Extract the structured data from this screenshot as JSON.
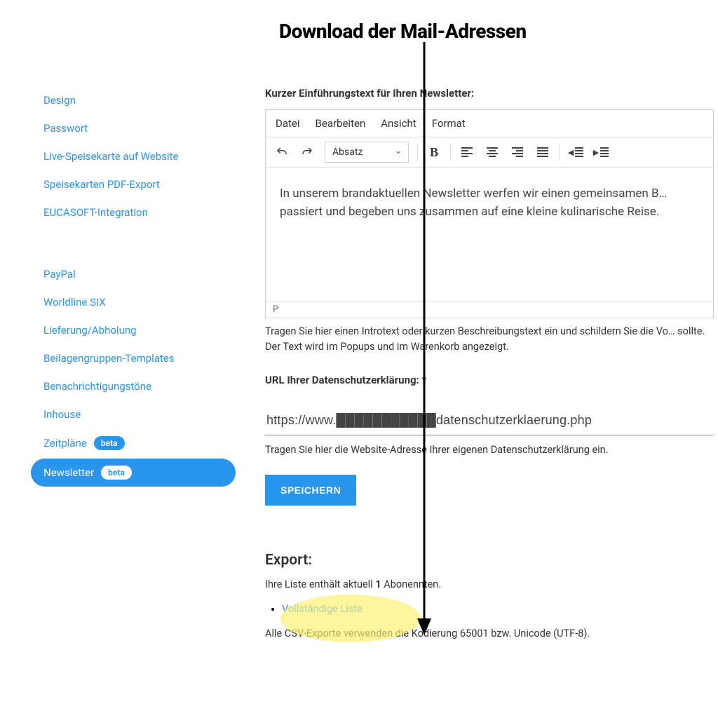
{
  "annotation": {
    "title": "Download der Mail-Adressen"
  },
  "sidebar": {
    "items": [
      {
        "label": "Design"
      },
      {
        "label": "Passwort"
      },
      {
        "label": "Live-Speisekarte auf Website"
      },
      {
        "label": "Speisekarten PDF-Export"
      },
      {
        "label": "EUCASOFT-Integration"
      }
    ],
    "items2": [
      {
        "label": "PayPal"
      },
      {
        "label": "Worldline SIX"
      },
      {
        "label": "Lieferung/Abholung"
      },
      {
        "label": "Beilagengruppen-Templates"
      },
      {
        "label": "Benachrichtigungstöne"
      },
      {
        "label": "Inhouse"
      },
      {
        "label": "Zeitpläne",
        "badge": "beta"
      },
      {
        "label": "Newsletter",
        "badge": "beta",
        "active": true
      }
    ]
  },
  "main": {
    "intro_label": "Kurzer Einführungstext für Ihren Newsletter:",
    "editor_menu": {
      "file": "Datei",
      "edit": "Bearbeiten",
      "view": "Ansicht",
      "format": "Format"
    },
    "editor_block": "Absatz",
    "editor_content": "In unserem brandaktuellen Newsletter werfen wir einen gemeinsamen B… passiert und begeben uns zusammen auf eine kleine kulinarische Reise.",
    "editor_status": "P",
    "intro_helper": "Tragen Sie hier einen Introtext oder kurzen Beschreibungstext ein und schildern Sie die Vo… sollte. Der Text wird im Popups und im Warenkorb angezeigt.",
    "url_label": "URL Ihrer Datenschutzerklärung: *",
    "url_value": "https://www.███████████datenschutzerklaerung.php",
    "url_helper": "Tragen Sie hier die Website-Adresse Ihrer eigenen Datenschutzerklärung ein.",
    "save": "SPEICHERN",
    "export": {
      "title": "Export:",
      "count_prefix": "Ihre Liste enthält aktuell ",
      "count": "1",
      "count_suffix": " Abonennten.",
      "link": "Vollständige Liste",
      "encoding": "Alle CSV-Exporte verwenden die Kodierung 65001 bzw. Unicode (UTF-8)."
    }
  }
}
